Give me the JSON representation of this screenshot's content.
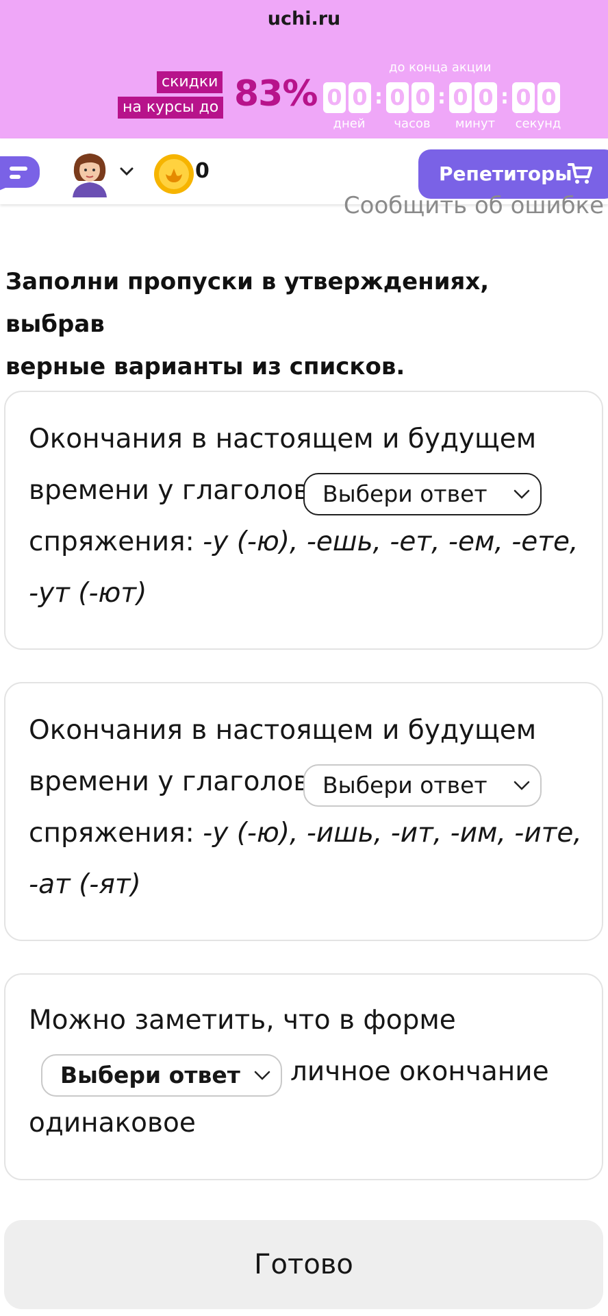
{
  "banner": {
    "site": "uchi.ru",
    "discount_line1": "скидки",
    "discount_line2": "на курсы до",
    "percent": "83%",
    "timer_title": "до конца акции",
    "digits": [
      "0",
      "0",
      "0",
      "0",
      "0",
      "0",
      "0",
      "0"
    ],
    "units": [
      "дней",
      "часов",
      "минут",
      "секунд"
    ],
    "colors": {
      "background": "#efa7f8",
      "accent": "#b7138b"
    }
  },
  "nav": {
    "coins": "0",
    "tutor_button": "Репетиторы",
    "icons": [
      "chat-icon",
      "avatar-icon",
      "chevron-down-icon",
      "coin-icon",
      "cart-icon"
    ],
    "accent": "#7a62e6"
  },
  "report_error": "Сообщить об ошибке",
  "instruction": {
    "line1": "Заполни пропуски в утверждениях, выбрав",
    "line2": "верные варианты из списков."
  },
  "cards": [
    {
      "line1": "Окончания в настоящем и будущем",
      "line2_prefix": "времени у глаголов",
      "select": "Выбери ответ",
      "line3_prefix": "спряжения:",
      "line3_italic": "-у (-ю), -ешь, -ет, -ем, -ете,",
      "line4_italic": "-ут (-ют)"
    },
    {
      "line1": "Окончания в настоящем и будущем",
      "line2_prefix": "времени у глаголов",
      "select": "Выбери ответ",
      "line3_prefix": "спряжения:",
      "line3_italic": "-у (-ю), -ишь, -ит, -им, -ите,",
      "line4_italic": "-ат (-ят)"
    },
    {
      "line1": "Можно заметить, что в форме",
      "select": "Выбери ответ",
      "line2_suffix": "личное окончание",
      "line3": "одинаковое"
    }
  ],
  "done_button": "Готово"
}
